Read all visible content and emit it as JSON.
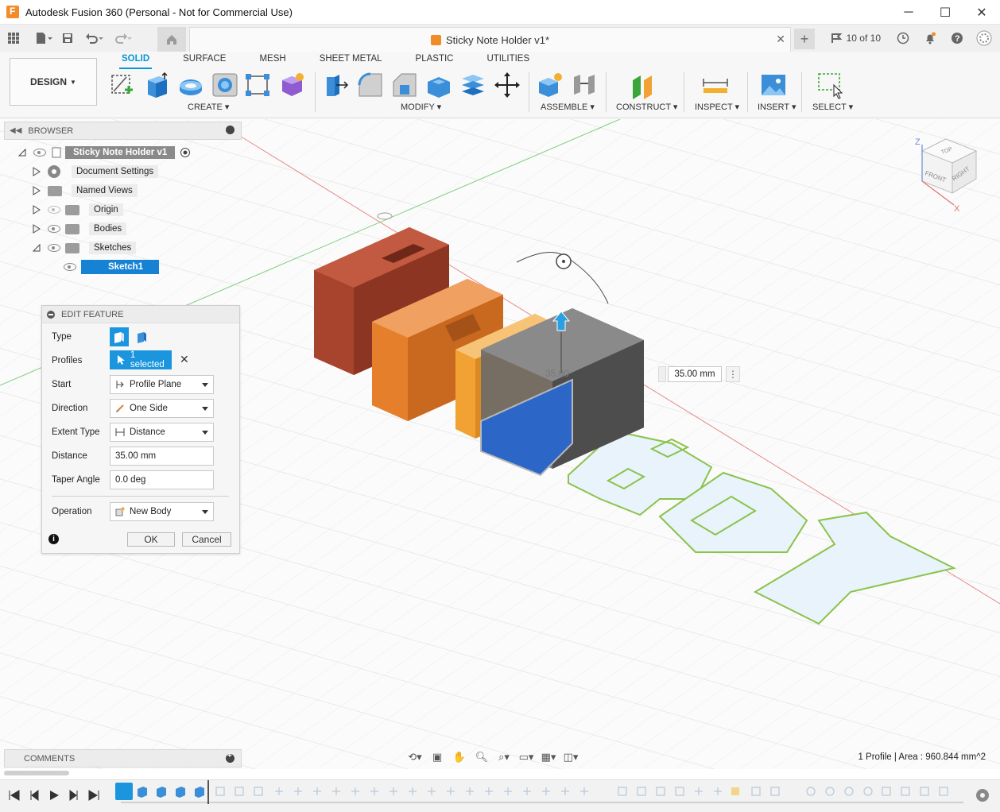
{
  "window": {
    "title": "Autodesk Fusion 360 (Personal - Not for Commercial Use)",
    "minimize": "─",
    "maximize": "☐",
    "close": "✕"
  },
  "quick_access": {
    "document_tab_title": "Sticky Note Holder v1*",
    "tab_close": "✕",
    "new_tab": "+",
    "jobs_label": "10 of 10"
  },
  "ribbon": {
    "workspace": "DESIGN",
    "tabs": [
      "SOLID",
      "SURFACE",
      "MESH",
      "SHEET METAL",
      "PLASTIC",
      "UTILITIES"
    ],
    "active_tab": "SOLID",
    "groups": {
      "create": "CREATE",
      "modify": "MODIFY",
      "assemble": "ASSEMBLE",
      "construct": "CONSTRUCT",
      "inspect": "INSPECT",
      "insert": "INSERT",
      "select": "SELECT"
    }
  },
  "browser": {
    "title": "BROWSER",
    "root": "Sticky Note Holder v1",
    "items": [
      {
        "label": "Document Settings",
        "icon": "gear-icon"
      },
      {
        "label": "Named Views",
        "icon": "folder-icon"
      },
      {
        "label": "Origin",
        "icon": "folder-icon"
      },
      {
        "label": "Bodies",
        "icon": "folder-icon"
      },
      {
        "label": "Sketches",
        "icon": "folder-icon"
      }
    ],
    "sketch": "Sketch1"
  },
  "edit_feature": {
    "title": "EDIT FEATURE",
    "type_label": "Type",
    "profiles_label": "Profiles",
    "profiles_value": "1 selected",
    "start_label": "Start",
    "start_value": "Profile Plane",
    "direction_label": "Direction",
    "direction_value": "One Side",
    "extent_label": "Extent Type",
    "extent_value": "Distance",
    "distance_label": "Distance",
    "distance_value": "35.00 mm",
    "taper_label": "Taper Angle",
    "taper_value": "0.0 deg",
    "operation_label": "Operation",
    "operation_value": "New Body",
    "ok": "OK",
    "cancel": "Cancel"
  },
  "viewport": {
    "dimension_value": "35.00 mm",
    "dimension_ghost": "35.00",
    "viewcube": {
      "top": "TOP",
      "front": "FRONT",
      "right": "RIGHT",
      "z": "Z",
      "x": "X"
    }
  },
  "comments": {
    "title": "COMMENTS"
  },
  "status": {
    "text": "1 Profile | Area : 960.844 mm^2"
  },
  "colors": {
    "accent": "#0696d7",
    "selection": "#1a95de",
    "letter_r": "#a8442e",
    "letter_a": "#e57f2c",
    "letter_i": "#f2a133",
    "letter_n": "#555555",
    "profile_blue": "#2c67c7",
    "sketch_green": "#8bc34a",
    "sketch_fill": "#e8f3fb"
  }
}
